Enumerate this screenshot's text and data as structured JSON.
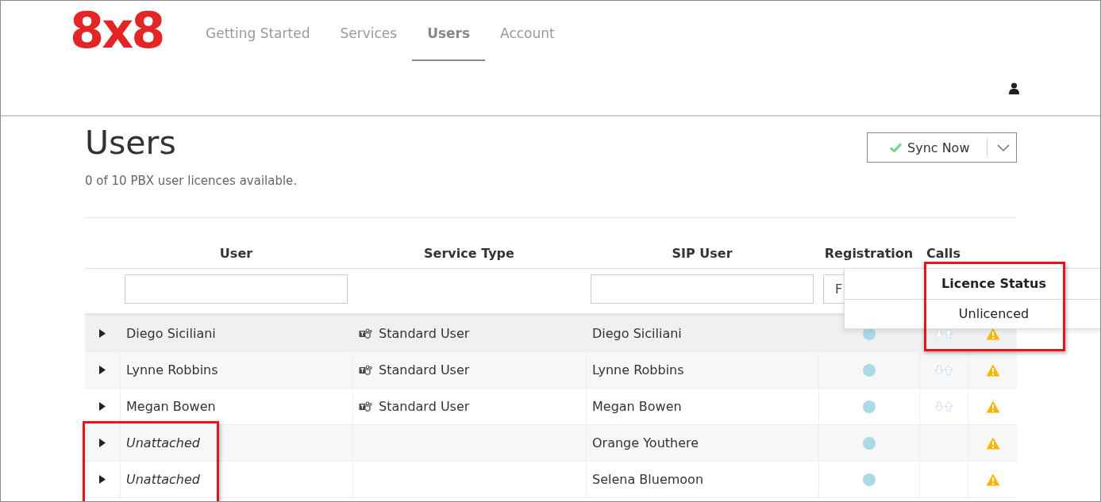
{
  "logo": {
    "text": "8x8"
  },
  "nav": [
    {
      "label": "Getting Started",
      "selected": false
    },
    {
      "label": "Services",
      "selected": false
    },
    {
      "label": "Users",
      "selected": true
    },
    {
      "label": "Account",
      "selected": false
    }
  ],
  "page": {
    "title": "Users",
    "subtitle": "0 of 10 PBX user licences available."
  },
  "sync_button": {
    "label": "Sync Now"
  },
  "table": {
    "columns": [
      "User",
      "Service Type",
      "SIP User",
      "Registration",
      "Calls"
    ],
    "filters": [
      {
        "kind": "text"
      },
      {
        "kind": "none"
      },
      {
        "kind": "text"
      },
      {
        "kind": "select",
        "value": "F"
      }
    ],
    "rows": [
      {
        "user": "Diego Siciliani",
        "attached": true,
        "service_type": "Standard User",
        "sip_user": "Diego Siciliani",
        "calls": true,
        "warning": true,
        "hovered": true,
        "highlighted": false
      },
      {
        "user": "Lynne Robbins",
        "attached": true,
        "service_type": "Standard User",
        "sip_user": "Lynne Robbins",
        "calls": true,
        "warning": true,
        "hovered": false,
        "highlighted": false
      },
      {
        "user": "Megan Bowen",
        "attached": true,
        "service_type": "Standard User",
        "sip_user": "Megan Bowen",
        "calls": true,
        "warning": true,
        "hovered": false,
        "highlighted": false
      },
      {
        "user": "Unattached",
        "attached": false,
        "sip_user": "Orange Youthere",
        "calls": false,
        "warning": true,
        "hovered": false,
        "highlighted": true
      },
      {
        "user": "Unattached",
        "attached": false,
        "sip_user": "Selena Bluemoon",
        "calls": false,
        "warning": true,
        "hovered": false,
        "highlighted": true
      }
    ]
  },
  "popup": {
    "header": "Licence Status",
    "options": [
      "Unlicenced"
    ],
    "highlighted": true
  }
}
